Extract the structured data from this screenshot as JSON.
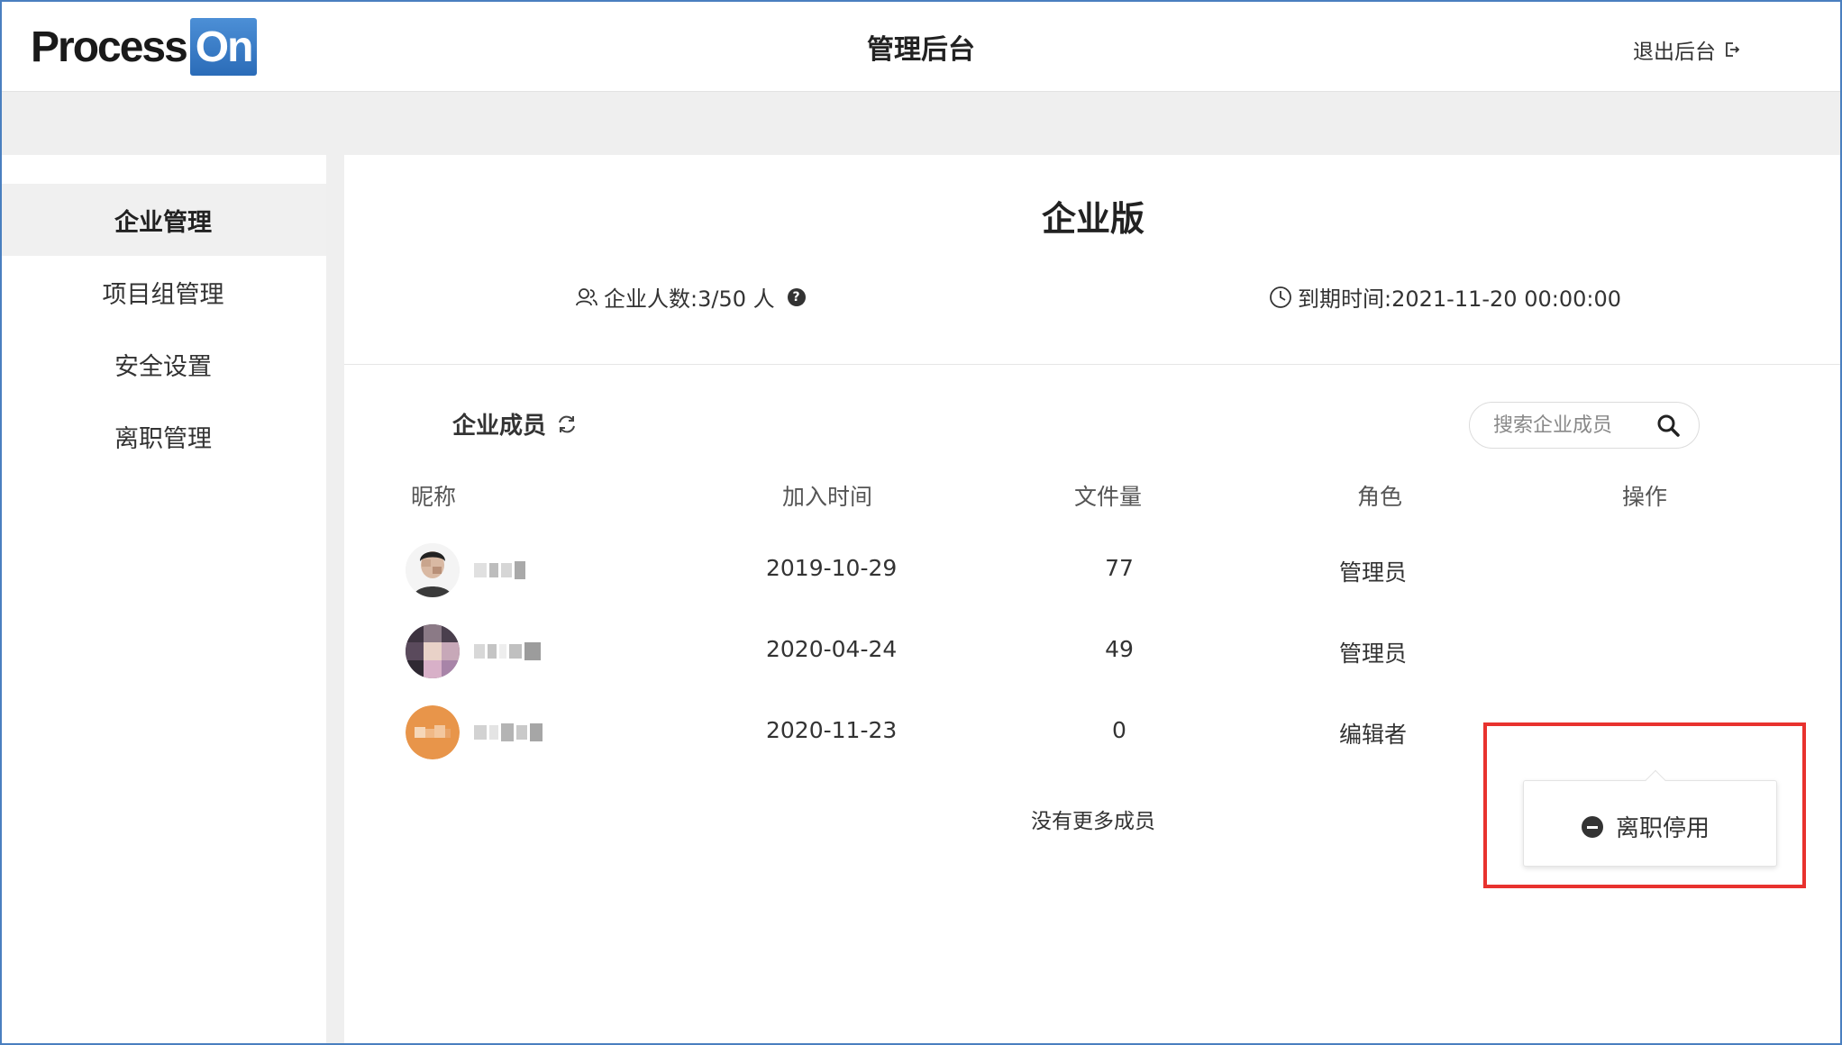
{
  "header": {
    "logo_left": "Process",
    "logo_right": "On",
    "title": "管理后台",
    "logout_label": "退出后台"
  },
  "sidebar": {
    "items": [
      {
        "label": "企业管理",
        "active": true
      },
      {
        "label": "项目组管理",
        "active": false
      },
      {
        "label": "安全设置",
        "active": false
      },
      {
        "label": "离职管理",
        "active": false
      }
    ]
  },
  "plan": {
    "title": "企业版",
    "members_label": "企业人数:3/50 人",
    "expire_label": "到期时间:2021-11-20 00:00:00"
  },
  "members": {
    "section_title": "企业成员",
    "search_placeholder": "搜索企业成员",
    "columns": [
      "昵称",
      "加入时间",
      "文件量",
      "角色",
      "操作"
    ],
    "rows": [
      {
        "join_date": "2019-10-29",
        "files": "77",
        "role": "管理员"
      },
      {
        "join_date": "2020-04-24",
        "files": "49",
        "role": "管理员"
      },
      {
        "join_date": "2020-11-23",
        "files": "0",
        "role": "编辑者",
        "ops": "···"
      }
    ],
    "footer": "没有更多成员"
  },
  "popover": {
    "item_label": "离职停用"
  },
  "colors": {
    "brand_blue": "#2b6cb8",
    "highlight_red": "#e8322e",
    "avatar_orange": "#e8954a"
  }
}
